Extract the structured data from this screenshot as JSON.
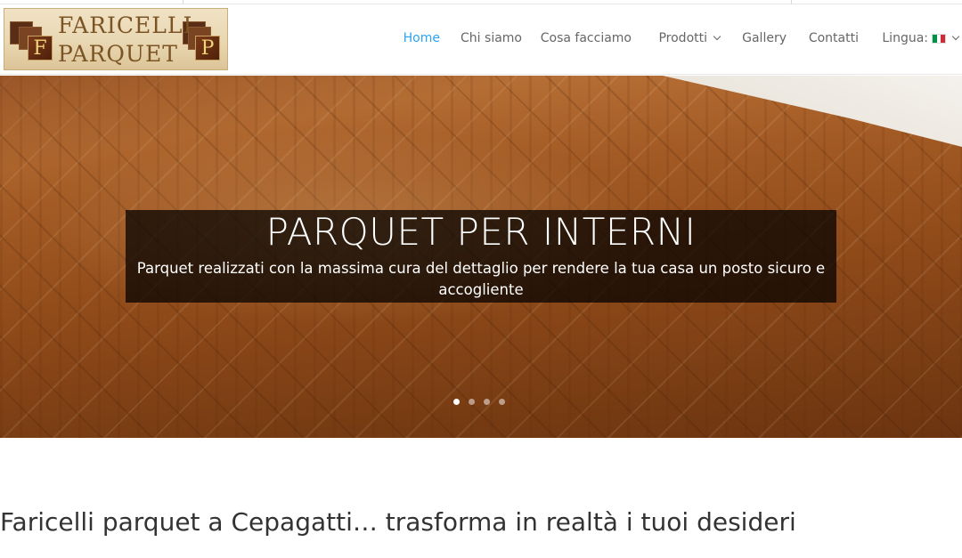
{
  "header": {
    "logo": {
      "line1": "FARICELLI",
      "line2": "PARQUET",
      "letter_left": "F",
      "letter_right": "P"
    },
    "nav": [
      {
        "label": "Home",
        "active": true,
        "dropdown": false
      },
      {
        "label": "Chi siamo",
        "active": false,
        "dropdown": false
      },
      {
        "label": "Cosa facciamo",
        "active": false,
        "dropdown": false
      },
      {
        "label": "Prodotti",
        "active": false,
        "dropdown": true
      },
      {
        "label": "Gallery",
        "active": false,
        "dropdown": false
      },
      {
        "label": "Contatti",
        "active": false,
        "dropdown": false
      },
      {
        "label": "Lingua:",
        "active": false,
        "dropdown": true,
        "icon": "italy-flag-icon"
      }
    ]
  },
  "hero": {
    "title": "PARQUET PER INTERNI",
    "text": "Parquet realizzati con la massima cura del dettaglio per rendere la tua casa un  posto sicuro e accogliente",
    "slides": 4,
    "active_slide": 1
  },
  "main": {
    "headline": "Faricelli parquet a Cepagatti… trasforma in realtà i tuoi desideri"
  },
  "colors": {
    "accent": "#2ea3f2",
    "nav_text": "#666666",
    "caption_bg": "rgba(0,0,0,0.72)",
    "flag": [
      "#009246",
      "#ffffff",
      "#ce2b37"
    ]
  }
}
